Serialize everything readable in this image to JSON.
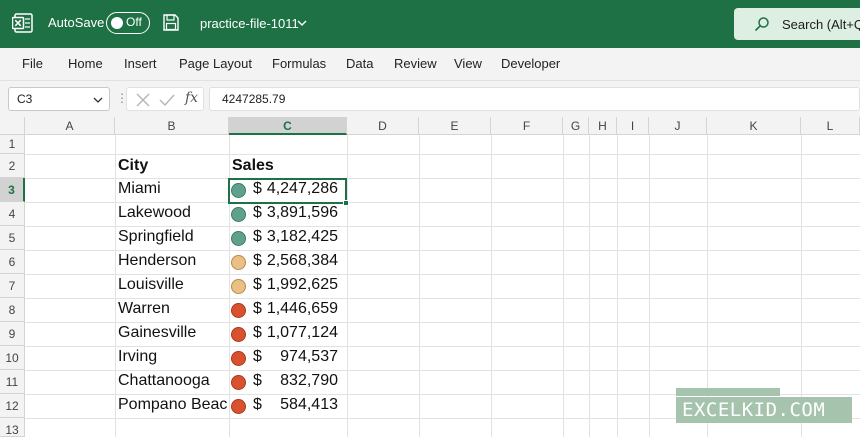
{
  "titlebar": {
    "autosave_label": "AutoSave",
    "autosave_state": "Off",
    "filename": "practice-file-1011",
    "search_placeholder": "Search (Alt+Q)"
  },
  "menu": [
    "File",
    "Home",
    "Insert",
    "Page Layout",
    "Formulas",
    "Data",
    "Review",
    "View",
    "Developer"
  ],
  "formula_bar": {
    "name_box": "C3",
    "value": "4247285.79"
  },
  "columns": [
    "A",
    "B",
    "C",
    "D",
    "E",
    "F",
    "G",
    "H",
    "I",
    "J",
    "K",
    "L"
  ],
  "rows": [
    "1",
    "2",
    "3",
    "4",
    "5",
    "6",
    "7",
    "8",
    "9",
    "10",
    "11",
    "12",
    "13"
  ],
  "active_cell": "C3",
  "table": {
    "headers": {
      "city": "City",
      "sales": "Sales"
    },
    "currency_symbol": "$",
    "rows": [
      {
        "city": "Miami",
        "amount": "4,247,286",
        "level": "green"
      },
      {
        "city": "Lakewood",
        "amount": "3,891,596",
        "level": "green"
      },
      {
        "city": "Springfield",
        "amount": "3,182,425",
        "level": "green"
      },
      {
        "city": "Henderson",
        "amount": "2,568,384",
        "level": "yellow"
      },
      {
        "city": "Louisville",
        "amount": "1,992,625",
        "level": "yellow"
      },
      {
        "city": "Warren",
        "amount": "1,446,659",
        "level": "red"
      },
      {
        "city": "Gainesville",
        "amount": "1,077,124",
        "level": "red"
      },
      {
        "city": "Irving",
        "amount": "974,537",
        "level": "red"
      },
      {
        "city": "Chattanooga",
        "amount": "832,790",
        "level": "red"
      },
      {
        "city": "Pompano Beach",
        "amount": "584,413",
        "level": "red"
      }
    ]
  },
  "icon_colors": {
    "green": "#5fa18d",
    "yellow": "#eac084",
    "red": "#d8522f"
  },
  "watermark": "EXCELKID.COM",
  "colors": {
    "titlebar": "#1e7145",
    "accent": "#1e7145"
  }
}
